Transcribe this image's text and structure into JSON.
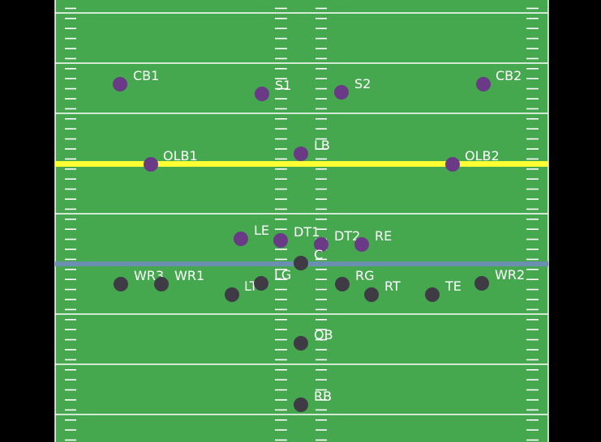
{
  "colors": {
    "background": "#000000",
    "field": "#45a84f",
    "yard_line": "#ffffff",
    "hash_mark": "#ffffff",
    "first_down_line": "#ffff33",
    "line_of_scrimmage": "#6a8fb0",
    "defense": "#6b3a86",
    "offense": "#3f3b45",
    "label": "#ffffff"
  },
  "defense": [
    {
      "id": "cb1",
      "label": "CB1"
    },
    {
      "id": "s1",
      "label": "S1"
    },
    {
      "id": "s2",
      "label": "S2"
    },
    {
      "id": "cb2",
      "label": "CB2"
    },
    {
      "id": "mlb",
      "label": "LB"
    },
    {
      "id": "olb1",
      "label": "OLB1"
    },
    {
      "id": "olb2",
      "label": "OLB2"
    },
    {
      "id": "le",
      "label": "LE"
    },
    {
      "id": "dt1",
      "label": "DT1"
    },
    {
      "id": "dt2",
      "label": "DT2"
    },
    {
      "id": "re",
      "label": "RE"
    }
  ],
  "offense": [
    {
      "id": "c",
      "label": "C"
    },
    {
      "id": "wr3",
      "label": "WR3"
    },
    {
      "id": "wr1",
      "label": "WR1"
    },
    {
      "id": "lt",
      "label": "LT"
    },
    {
      "id": "lg",
      "label": "LG"
    },
    {
      "id": "rg",
      "label": "RG"
    },
    {
      "id": "rt",
      "label": "RT"
    },
    {
      "id": "te",
      "label": "TE"
    },
    {
      "id": "wr2",
      "label": "WR2"
    },
    {
      "id": "qb",
      "label": "QB"
    },
    {
      "id": "rb",
      "label": "RB"
    }
  ]
}
